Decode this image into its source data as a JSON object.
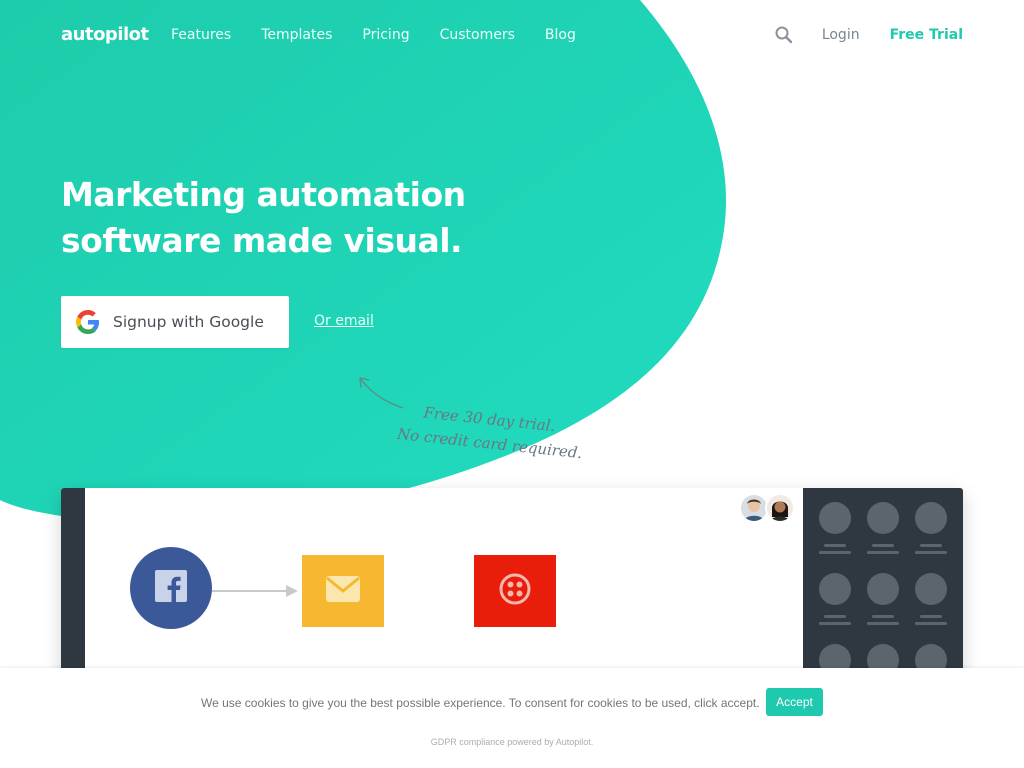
{
  "nav": {
    "logo": "autopilot",
    "links": [
      "Features",
      "Templates",
      "Pricing",
      "Customers",
      "Blog"
    ],
    "login": "Login",
    "free_trial": "Free Trial"
  },
  "hero": {
    "headline_line1": "Marketing automation",
    "headline_line2": "software made visual.",
    "google_button": "Signup with Google",
    "or_email": "Or email",
    "note_line1": "Free 30 day trial.",
    "note_line2": "No credit card required."
  },
  "cookie": {
    "message": "We use cookies to give you the best possible experience. To consent for cookies to be used, click accept.",
    "accept": "Accept",
    "gdpr": "GDPR compliance powered by Autopilot."
  },
  "colors": {
    "brand_teal": "#1fc9ad",
    "facebook_blue": "#3b5998",
    "mail_yellow": "#f6b731",
    "twilio_red": "#e81e0b",
    "dark_panel": "#2f3840"
  },
  "icons": {
    "search": "search-icon",
    "google": "google-icon",
    "facebook": "facebook-icon",
    "mail": "mail-icon",
    "twilio": "twilio-icon"
  }
}
